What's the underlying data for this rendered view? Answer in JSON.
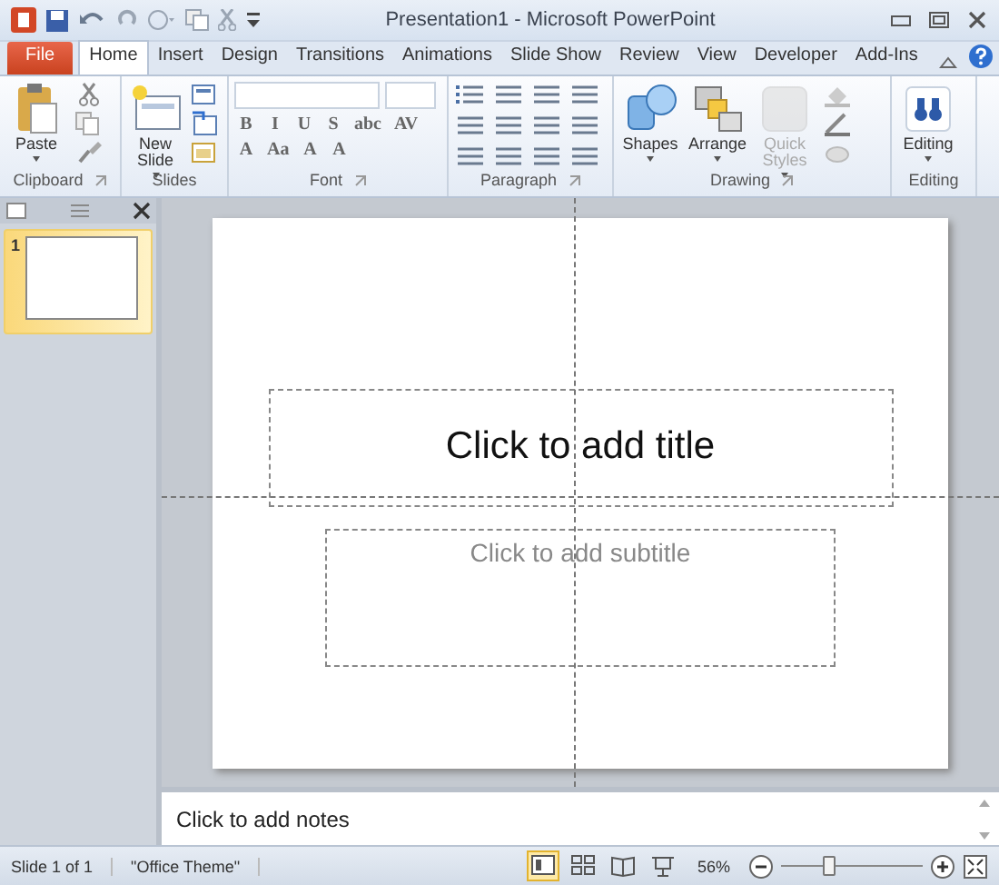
{
  "window": {
    "title": "Presentation1  -  Microsoft PowerPoint"
  },
  "tabs": [
    {
      "label": "File",
      "kind": "file",
      "selected": false
    },
    {
      "label": "Home",
      "kind": "tab",
      "selected": true
    },
    {
      "label": "Insert",
      "kind": "tab",
      "selected": false
    },
    {
      "label": "Design",
      "kind": "tab",
      "selected": false
    },
    {
      "label": "Transitions",
      "kind": "tab",
      "selected": false
    },
    {
      "label": "Animations",
      "kind": "tab",
      "selected": false
    },
    {
      "label": "Slide Show",
      "kind": "tab",
      "selected": false
    },
    {
      "label": "Review",
      "kind": "tab",
      "selected": false
    },
    {
      "label": "View",
      "kind": "tab",
      "selected": false
    },
    {
      "label": "Developer",
      "kind": "tab",
      "selected": false
    },
    {
      "label": "Add-Ins",
      "kind": "tab",
      "selected": false
    }
  ],
  "ribbon": {
    "groups": [
      {
        "kind": "clipboard",
        "label": "Clipboard",
        "buttons": [
          {
            "label": "Paste",
            "disabled": false
          }
        ]
      },
      {
        "kind": "slides",
        "label": "Slides",
        "buttons": [
          {
            "label": "New Slide",
            "disabled": false
          }
        ]
      },
      {
        "kind": "font",
        "label": "Font",
        "glyphs_row1": [
          "B",
          "I",
          "U",
          "S",
          "abc",
          "AV"
        ],
        "glyphs_row2": [
          "A",
          "Aa",
          "A",
          "A"
        ]
      },
      {
        "kind": "paragraph",
        "label": "Paragraph"
      },
      {
        "kind": "drawing",
        "label": "Drawing",
        "buttons": [
          {
            "label": "Shapes",
            "disabled": false
          },
          {
            "label": "Arrange",
            "disabled": false
          },
          {
            "label": "Quick Styles",
            "disabled": true
          }
        ]
      },
      {
        "kind": "editing",
        "label": "Editing",
        "buttons": [
          {
            "label": "Editing",
            "disabled": false
          }
        ]
      }
    ]
  },
  "slides_pane": {
    "thumbnails": [
      {
        "number": "1",
        "selected": true
      }
    ]
  },
  "slide": {
    "title_placeholder": "Click to add title",
    "subtitle_placeholder": "Click to add subtitle"
  },
  "notes": {
    "placeholder": "Click to add notes"
  },
  "status_bar": {
    "slide_info": "Slide 1 of 1",
    "theme": "\"Office Theme\"",
    "views": [
      {
        "kind": "normal",
        "selected": true
      },
      {
        "kind": "sorter",
        "selected": false
      },
      {
        "kind": "reading",
        "selected": false
      },
      {
        "kind": "slideshow",
        "selected": false
      }
    ],
    "zoom": "56%",
    "zoom_slider": {
      "level": 0.33
    }
  }
}
